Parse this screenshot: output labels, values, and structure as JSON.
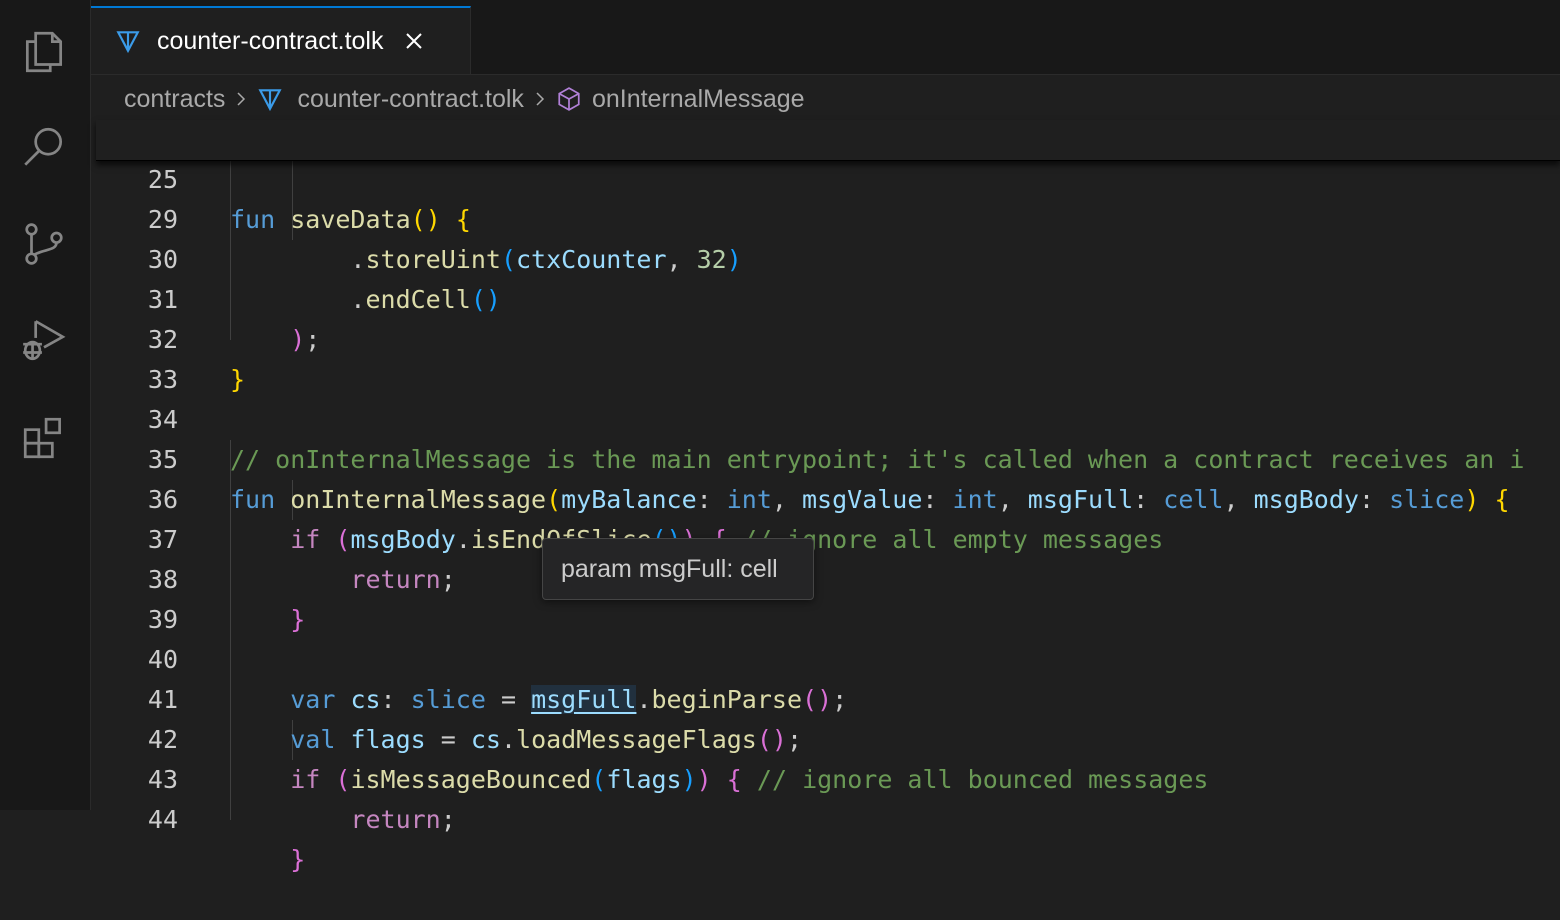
{
  "tab": {
    "label": "counter-contract.tolk"
  },
  "breadcrumb": {
    "folder": "contracts",
    "file": "counter-contract.tolk",
    "symbol": "onInternalMessage"
  },
  "hover": {
    "text": "param msgFull: cell"
  },
  "colors": {
    "accent": "#0078d4",
    "editor_bg": "#1f1f1f",
    "keyword": "#569cd6",
    "function": "#dcdcaa",
    "variable": "#9cdcfe",
    "comment": "#6a9955"
  },
  "code": {
    "sticky": {
      "line_number": "25",
      "text": "fun saveData() {"
    },
    "lines": [
      {
        "n": "29",
        "text": "        .storeUint(ctxCounter, 32)"
      },
      {
        "n": "30",
        "text": "        .endCell()"
      },
      {
        "n": "31",
        "text": "    );"
      },
      {
        "n": "32",
        "text": "}"
      },
      {
        "n": "33",
        "text": ""
      },
      {
        "n": "34",
        "text": "// onInternalMessage is the main entrypoint; it's called when a contract receives an i"
      },
      {
        "n": "35",
        "text": "fun onInternalMessage(myBalance: int, msgValue: int, msgFull: cell, msgBody: slice) {"
      },
      {
        "n": "36",
        "text": "    if (msgBody.isEndOfSlice()) { // ignore all empty messages"
      },
      {
        "n": "37",
        "text": "        return;"
      },
      {
        "n": "38",
        "text": "    }"
      },
      {
        "n": "39",
        "text": ""
      },
      {
        "n": "40",
        "text": "    var cs: slice = msgFull.beginParse();"
      },
      {
        "n": "41",
        "text": "    val flags = cs.loadMessageFlags();"
      },
      {
        "n": "42",
        "text": "    if (isMessageBounced(flags)) { // ignore all bounced messages"
      },
      {
        "n": "43",
        "text": "        return;"
      },
      {
        "n": "44",
        "text": "    }"
      }
    ]
  },
  "activity_bar": [
    "explorer-icon",
    "search-icon",
    "source-control-icon",
    "run-debug-icon",
    "extensions-icon"
  ]
}
